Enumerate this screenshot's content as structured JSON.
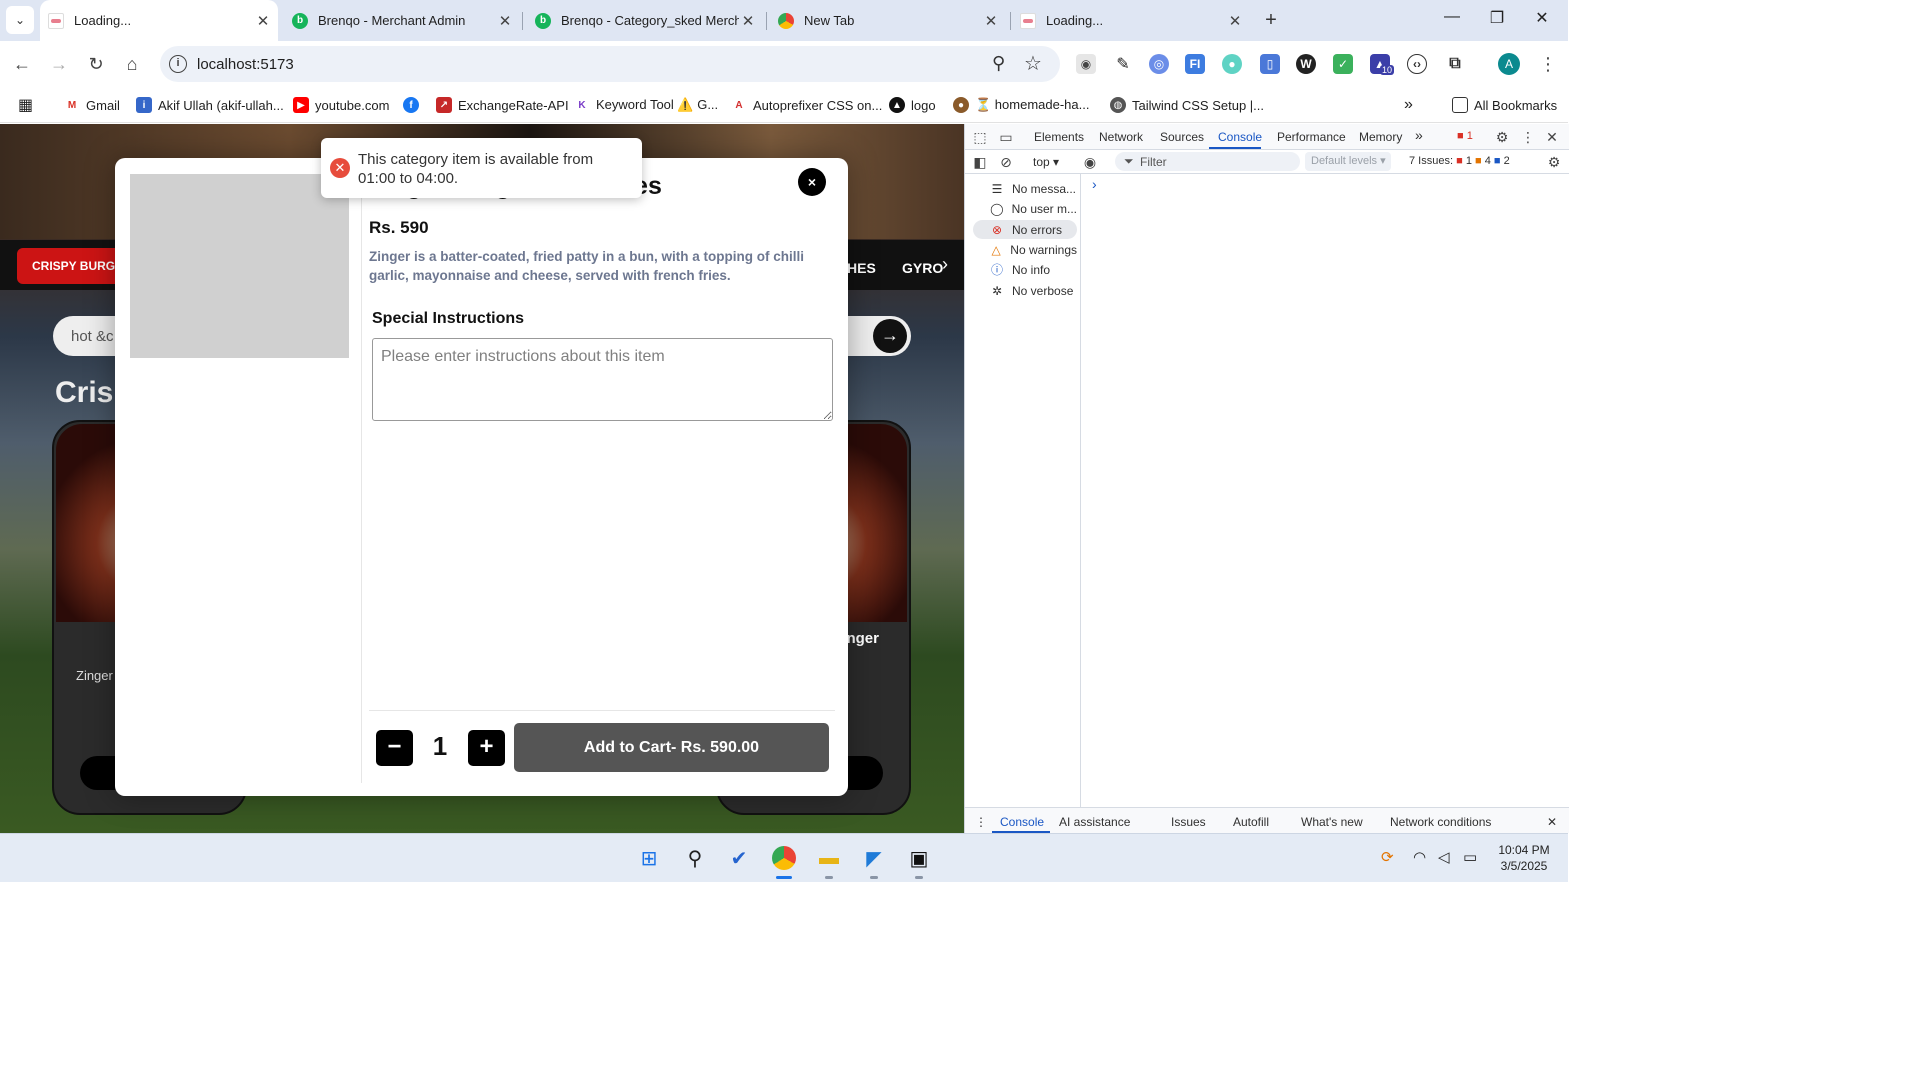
{
  "browser": {
    "tabs": [
      {
        "title": "Loading...",
        "active": true
      },
      {
        "title": "Brenqo - Merchant Admin",
        "active": false
      },
      {
        "title": "Brenqo - Category_sked Merch",
        "active": false
      },
      {
        "title": "New Tab",
        "active": false
      },
      {
        "title": "Loading...",
        "active": false
      }
    ],
    "url": "localhost:5173",
    "profile_initial": "A",
    "extension_badge": "10",
    "bookmarks": [
      {
        "label": "Gmail"
      },
      {
        "label": "Akif Ullah (akif-ullah..."
      },
      {
        "label": "youtube.com"
      },
      {
        "label": "ExchangeRate-API"
      },
      {
        "label": "Keyword Tool ⚠️ G..."
      },
      {
        "label": "Autoprefixer CSS on..."
      },
      {
        "label": "logo"
      },
      {
        "label": "⏳ homemade-ha..."
      },
      {
        "label": "Tailwind CSS Setup |..."
      }
    ],
    "all_bookmarks": "All Bookmarks"
  },
  "page": {
    "category_chip": "CRISPY BURG",
    "category_tail_1": "HES",
    "category_tail_2": "GYRO",
    "search_value": "hot &c",
    "heading": "Crisp",
    "card_left_name": "Zi",
    "card_left_desc": "Zinger fried p",
    "card_right_name": "nger"
  },
  "modal": {
    "title": "Zinger Burger With Fries",
    "price": "Rs. 590",
    "description": "Zinger is a batter-coated, fried patty in a bun, with a topping of chilli garlic, mayonnaise and cheese, served with french fries.",
    "special_instructions_label": "Special Instructions",
    "instructions_placeholder": "Please enter instructions about this item",
    "quantity": "1",
    "minus": "−",
    "plus": "+",
    "add_to_cart": "Add to Cart- Rs. 590.00",
    "close": "×"
  },
  "toast": {
    "message": "This category item is available from 01:00 to 04:00.",
    "type": "error"
  },
  "devtools": {
    "tabs": [
      "Elements",
      "Network",
      "Sources",
      "Console",
      "Performance",
      "Memory"
    ],
    "active_tab": "Console",
    "error_badge": "1",
    "context": "top",
    "filter_placeholder": "Filter",
    "levels": "Default levels",
    "issues_label": "7 Issues:",
    "issues_errors": "1",
    "issues_warnings": "4",
    "issues_info": "2",
    "sidebar": [
      {
        "label": "No messa...",
        "icon": "list-icon"
      },
      {
        "label": "No user m...",
        "icon": "user-icon"
      },
      {
        "label": "No errors",
        "icon": "error-icon",
        "selected": true
      },
      {
        "label": "No warnings",
        "icon": "warning-icon"
      },
      {
        "label": "No info",
        "icon": "info-icon"
      },
      {
        "label": "No verbose",
        "icon": "bug-icon"
      }
    ],
    "drawer_tabs": [
      "Console",
      "AI assistance",
      "Issues",
      "Autofill",
      "What's new",
      "Network conditions"
    ]
  },
  "taskbar": {
    "time": "10:04 PM",
    "date": "3/5/2025"
  },
  "colors": {
    "accent_red": "#cc1414",
    "devtools_blue": "#1a57c4",
    "toast_error": "#e74c3c",
    "add_cart_bg": "#555555",
    "brand_green": "#16b45a"
  }
}
